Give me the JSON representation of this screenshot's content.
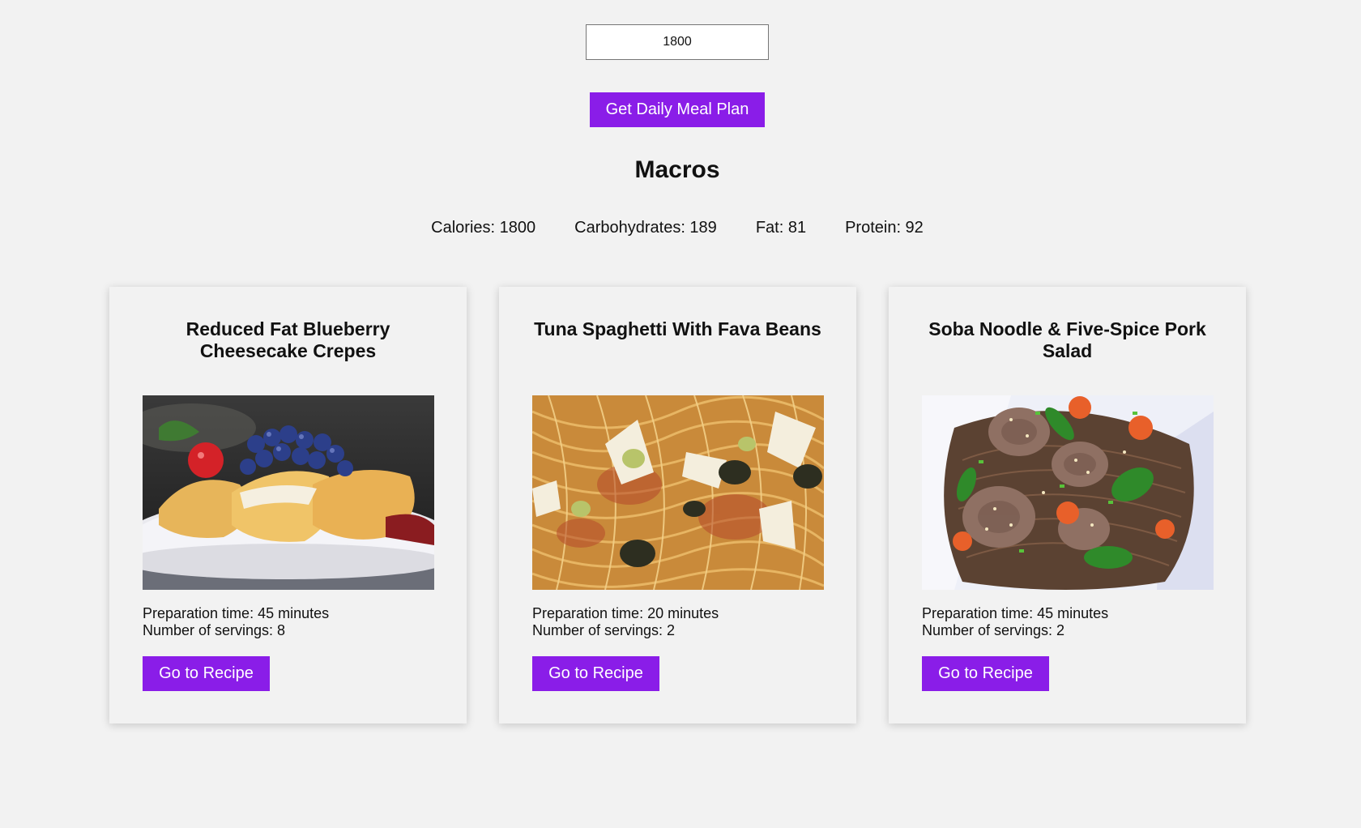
{
  "calorie_input": {
    "value": "1800"
  },
  "get_plan_button": {
    "label": "Get Daily Meal Plan"
  },
  "macros": {
    "title": "Macros",
    "items": [
      {
        "label": "Calories: 1800"
      },
      {
        "label": "Carbohydrates: 189"
      },
      {
        "label": "Fat: 81"
      },
      {
        "label": "Protein: 92"
      }
    ]
  },
  "meals": [
    {
      "title": "Reduced Fat Blueberry Cheesecake Crepes",
      "prep_time": "Preparation time: 45 minutes",
      "servings": "Number of servings: 8",
      "button_label": "Go to Recipe"
    },
    {
      "title": "Tuna Spaghetti With Fava Beans",
      "prep_time": "Preparation time: 20 minutes",
      "servings": "Number of servings: 2",
      "button_label": "Go to Recipe"
    },
    {
      "title": "Soba Noodle & Five-Spice Pork Salad",
      "prep_time": "Preparation time: 45 minutes",
      "servings": "Number of servings: 2",
      "button_label": "Go to Recipe"
    }
  ],
  "colors": {
    "accent": "#8a1de8",
    "background": "#f2f2f2"
  }
}
